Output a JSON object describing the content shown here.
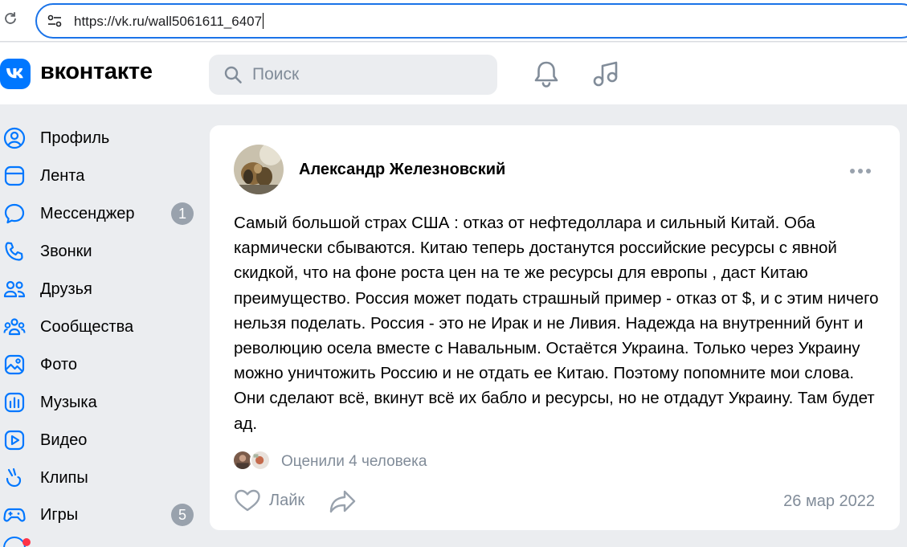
{
  "browser": {
    "url": "https://vk.ru/wall5061611_6407"
  },
  "header": {
    "logo_text": "вконтакте",
    "search_placeholder": "Поиск"
  },
  "sidebar": {
    "items": [
      {
        "label": "Профиль",
        "icon": "profile-icon"
      },
      {
        "label": "Лента",
        "icon": "feed-icon"
      },
      {
        "label": "Мессенджер",
        "icon": "messenger-icon",
        "badge": "1"
      },
      {
        "label": "Звонки",
        "icon": "phone-icon"
      },
      {
        "label": "Друзья",
        "icon": "friends-icon"
      },
      {
        "label": "Сообщества",
        "icon": "communities-icon"
      },
      {
        "label": "Фото",
        "icon": "photo-icon"
      },
      {
        "label": "Музыка",
        "icon": "music-icon"
      },
      {
        "label": "Видео",
        "icon": "video-icon"
      },
      {
        "label": "Клипы",
        "icon": "clips-icon"
      },
      {
        "label": "Игры",
        "icon": "games-icon",
        "badge": "5"
      }
    ]
  },
  "post": {
    "author": "Александр Железновский",
    "text": "Самый большой страх США : отказ от нефтедоллара и сильный Китай. Оба кармически сбываются. Китаю теперь достанутся российские ресурсы с явной скидкой, что на фоне роста цен на те же ресурсы для европы , даст Китаю преимущество. Россия может подать страшный пример - отказ от $, и с этим ничего нельзя поделать. Россия - это не Ирак и не Ливия. Надежда на внутренний бунт и революцию осела вместе с Навальным. Остаётся Украина. Только через Украину можно уничтожить Россию и не отдать ее Китаю. Поэтому попомните мои слова. Они сделают всё, вкинут всё их бабло и ресурсы, но не отдадут Украину. Там будет ад.",
    "liked_by": "Оценили 4 человека",
    "like_label": "Лайк",
    "date": "26 мар 2022"
  },
  "colors": {
    "accent": "#0077ff",
    "icon": "#0077ff",
    "secondary_text": "#818c99",
    "badge": "#99a2ad",
    "page_bg": "#ebedf0"
  }
}
